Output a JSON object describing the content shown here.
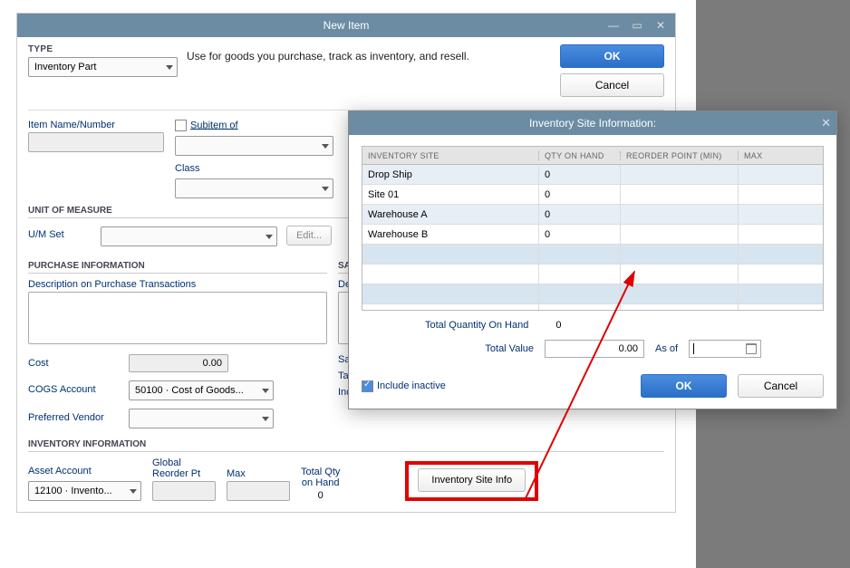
{
  "main_window": {
    "title": "New Item",
    "type_label": "TYPE",
    "type_value": "Inventory Part",
    "type_desc": "Use for goods you purchase, track as inventory, and resell.",
    "ok": "OK",
    "cancel": "Cancel",
    "item_name_label": "Item Name/Number",
    "subitem_label": "Subitem of",
    "class_label": "Class",
    "uom_header": "UNIT OF MEASURE",
    "uom_set_label": "U/M Set",
    "edit_btn": "Edit...",
    "purchase_header": "PURCHASE INFORMATION",
    "purchase_desc_label": "Description on Purchase Transactions",
    "cost_label": "Cost",
    "cost_value": "0.00",
    "cogs_label": "COGS Account",
    "cogs_value": "50100 · Cost of Goods...",
    "vendor_label": "Preferred Vendor",
    "sales_header": "SALES I",
    "sales_desc_label": "Descrip",
    "sales_price_label": "Sales P",
    "tax_label": "Tax Co",
    "income_label": "Income",
    "inv_header": "INVENTORY INFORMATION",
    "asset_label": "Asset Account",
    "asset_value": "12100 · Invento...",
    "reorder_label_line1": "Global",
    "reorder_label_line2": "Reorder Pt",
    "max_label": "Max",
    "total_qty_label_line1": "Total Qty",
    "total_qty_label_line2": "on Hand",
    "total_qty_value": "0",
    "inv_site_btn": "Inventory Site Info"
  },
  "modal": {
    "title": "Inventory Site Information:",
    "col_site": "INVENTORY SITE",
    "col_qty": "QTY ON HAND",
    "col_reorder": "REORDER POINT (MIN)",
    "col_max": "MAX",
    "rows": [
      {
        "site": "Drop Ship",
        "qty": "0",
        "reorder": "",
        "max": ""
      },
      {
        "site": "Site 01",
        "qty": "0",
        "reorder": "",
        "max": ""
      },
      {
        "site": "Warehouse A",
        "qty": "0",
        "reorder": "",
        "max": ""
      },
      {
        "site": "Warehouse B",
        "qty": "0",
        "reorder": "",
        "max": ""
      }
    ],
    "total_qty_label": "Total Quantity On Hand",
    "total_qty_value": "0",
    "total_val_label": "Total Value",
    "total_val_value": "0.00",
    "asof_label": "As of",
    "include_inactive": "Include inactive",
    "ok": "OK",
    "cancel": "Cancel"
  }
}
